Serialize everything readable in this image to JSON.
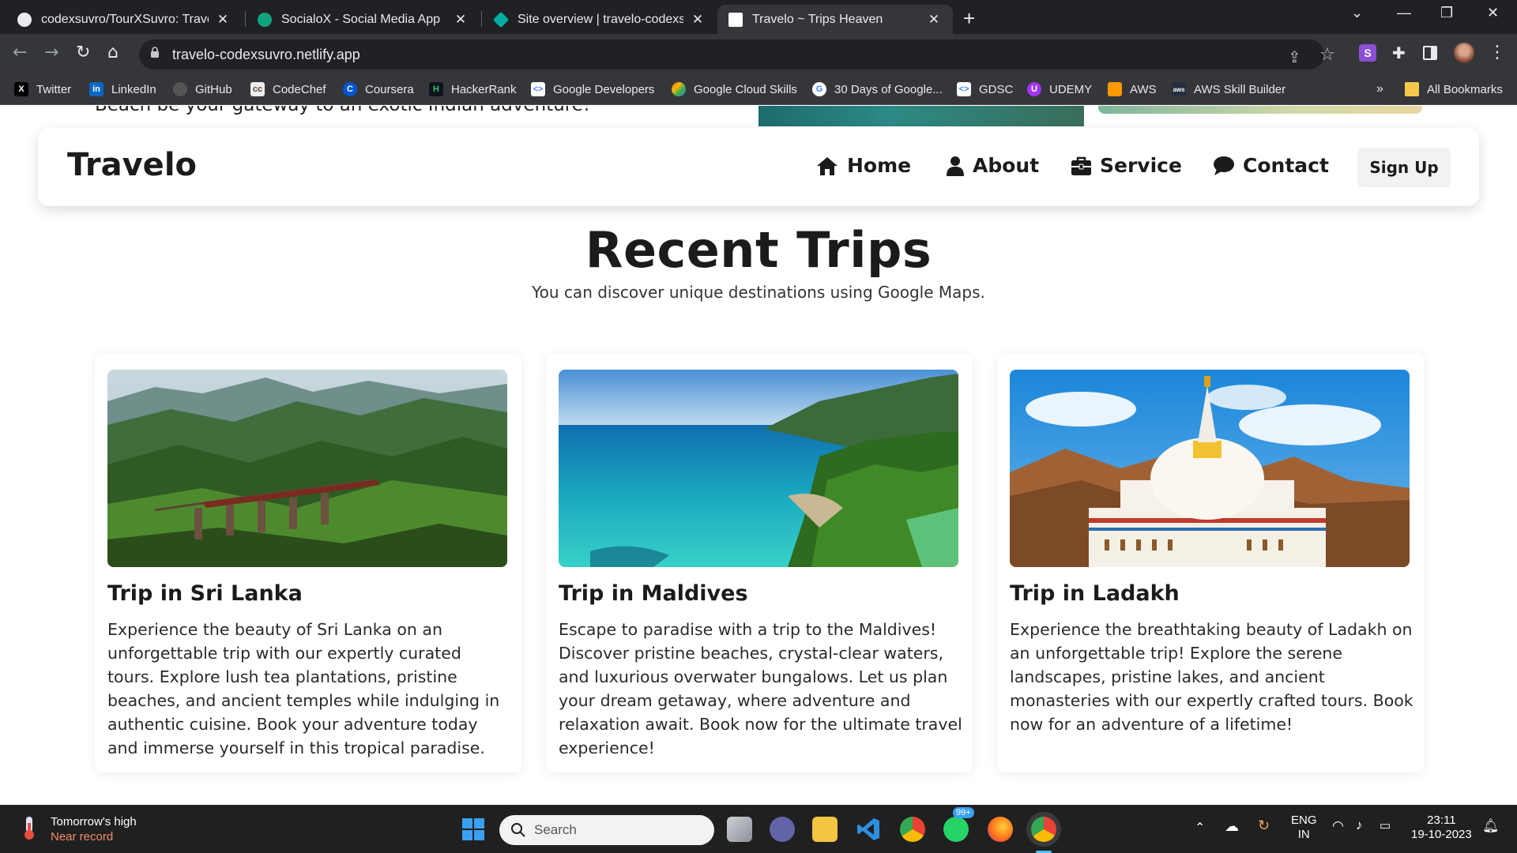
{
  "browser": {
    "tabs": [
      {
        "title": "codexsuvro/TourXSuvro: Travel a",
        "favicon_color": "#24292e"
      },
      {
        "title": "SocialoX - Social Media App",
        "favicon_color": "#10a37f"
      },
      {
        "title": "Site overview | travelo-codexsuv",
        "favicon_color": "#00ad9f"
      },
      {
        "title": "Travelo ~ Trips Heaven",
        "favicon_color": "#000000"
      }
    ],
    "new_tab": "+",
    "url": "travelo-codexsuvro.netlify.app",
    "bookmarks": [
      {
        "label": "Twitter",
        "icon": "x-logo-icon"
      },
      {
        "label": "LinkedIn",
        "icon": "linkedin-icon"
      },
      {
        "label": "GitHub",
        "icon": "github-icon"
      },
      {
        "label": "CodeChef",
        "icon": "codechef-icon"
      },
      {
        "label": "Coursera",
        "icon": "coursera-icon"
      },
      {
        "label": "HackerRank",
        "icon": "hackerrank-icon"
      },
      {
        "label": "Google Developers",
        "icon": "google-developers-icon"
      },
      {
        "label": "Google Cloud Skills",
        "icon": "google-cloud-icon"
      },
      {
        "label": "30 Days of Google...",
        "icon": "google-icon"
      },
      {
        "label": "GDSC",
        "icon": "gdsc-icon"
      },
      {
        "label": "UDEMY",
        "icon": "udemy-icon"
      },
      {
        "label": "AWS",
        "icon": "aws-icon"
      },
      {
        "label": "AWS Skill Builder",
        "icon": "aws-skill-builder-icon"
      }
    ],
    "overflow": "»",
    "all_bookmarks": "All Bookmarks"
  },
  "page": {
    "previous_section_text": "Beach be your gateway to an exotic Indian adventure!",
    "navbar": {
      "brand": "Travelo",
      "links": [
        {
          "label": "Home",
          "icon": "home-icon"
        },
        {
          "label": "About",
          "icon": "user-icon"
        },
        {
          "label": "Service",
          "icon": "briefcase-icon"
        },
        {
          "label": "Contact",
          "icon": "comment-icon"
        }
      ],
      "signup": "Sign Up"
    },
    "section": {
      "title": "Recent Trips",
      "subtitle": "You can discover unique destinations using Google Maps."
    },
    "trips": [
      {
        "title": "Trip in Sri Lanka",
        "description": "Experience the beauty of Sri Lanka on an unforgettable trip with our expertly curated tours. Explore lush tea plantations, pristine beaches, and ancient temples while indulging in authentic cuisine. Book your adventure today and immerse yourself in this tropical paradise."
      },
      {
        "title": "Trip in Maldives",
        "description": "Escape to paradise with a trip to the Maldives! Discover pristine beaches, crystal-clear waters, and luxurious overwater bungalows. Let us plan your dream getaway, where adventure and relaxation await. Book now for the ultimate travel experience!"
      },
      {
        "title": "Trip in Ladakh",
        "description": "Experience the breathtaking beauty of Ladakh on an unforgettable trip! Explore the serene landscapes, pristine lakes, and ancient monasteries with our expertly crafted tours. Book now for an adventure of a lifetime!"
      }
    ]
  },
  "taskbar": {
    "weather_line1": "Tomorrow's high",
    "weather_line2": "Near record",
    "search_placeholder": "Search",
    "whatsapp_badge": "99+",
    "lang_line1": "ENG",
    "lang_line2": "IN",
    "time": "23:11",
    "date": "19-10-2023"
  }
}
